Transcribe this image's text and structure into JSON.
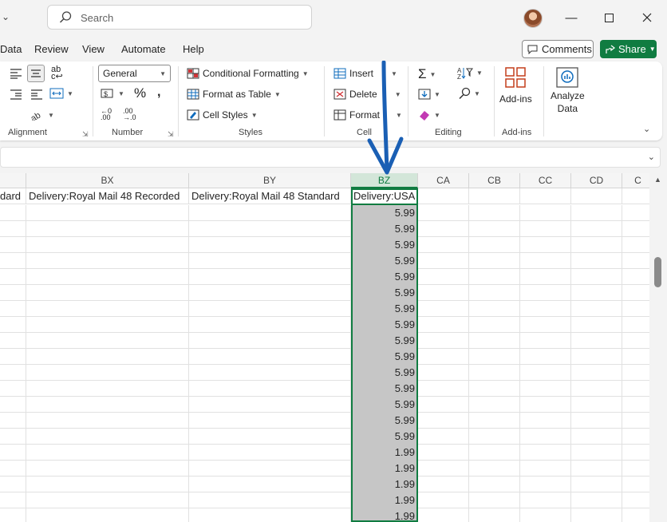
{
  "search": {
    "placeholder": "Search"
  },
  "menu": {
    "items": [
      "Data",
      "Review",
      "View",
      "Automate",
      "Help"
    ],
    "comments_label": "Comments",
    "share_label": "Share"
  },
  "ribbon": {
    "number_format": "General",
    "styles": {
      "conditional_formatting": "Conditional Formatting",
      "format_as_table": "Format as Table",
      "cell_styles": "Cell Styles"
    },
    "cells": {
      "insert": "Insert",
      "delete": "Delete",
      "format": "Format"
    },
    "addins": {
      "addins_label": "Add-ins",
      "analyze_data_line1": "Analyze",
      "analyze_data_line2": "Data"
    },
    "group_labels": {
      "alignment": "Alignment",
      "number": "Number",
      "styles": "Styles",
      "cells": "Cell",
      "editing": "Editing",
      "addins": "Add-ins"
    },
    "accent": "#107c41"
  },
  "grid": {
    "columns": [
      "BX",
      "BY",
      "BZ",
      "CA",
      "CB",
      "CC",
      "CD",
      "C"
    ],
    "headers": {
      "bw_partial": "dard",
      "bx": "Delivery:Royal Mail 48 Recorded",
      "by": "Delivery:Royal Mail 48 Standard",
      "bz": "Delivery:USA"
    },
    "bz_values": [
      "5.99",
      "5.99",
      "5.99",
      "5.99",
      "5.99",
      "5.99",
      "5.99",
      "5.99",
      "5.99",
      "5.99",
      "5.99",
      "5.99",
      "5.99",
      "5.99",
      "5.99",
      "1.99",
      "1.99",
      "1.99",
      "1.99",
      "1.99"
    ]
  }
}
